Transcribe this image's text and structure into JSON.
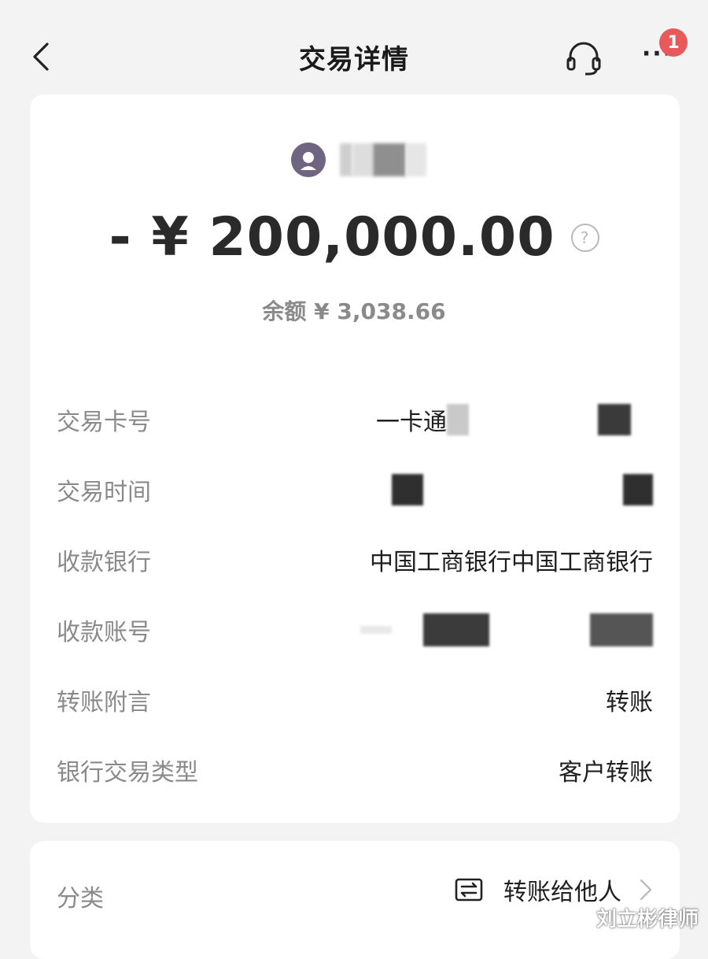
{
  "header": {
    "title": "交易详情",
    "notification_count": "1",
    "more_label": "···"
  },
  "transaction": {
    "amount": "- ¥ 200,000.00",
    "help_symbol": "?",
    "balance": "余额 ¥ 3,038.66"
  },
  "details": [
    {
      "label": "交易卡号",
      "value": "一卡通"
    },
    {
      "label": "交易时间",
      "value": ""
    },
    {
      "label": "收款银行",
      "value": "中国工商银行中国工商银行"
    },
    {
      "label": "收款账号",
      "value": ""
    },
    {
      "label": "转账附言",
      "value": "转账"
    },
    {
      "label": "银行交易类型",
      "value": "客户转账"
    }
  ],
  "category": {
    "label": "分类",
    "value": "转账给他人"
  },
  "watermark": "刘立彬律师",
  "colors": {
    "background": "#f3f3f3",
    "card": "#ffffff",
    "badge": "#e85a5a",
    "avatar": "#6f6583",
    "label_gray": "#8a8a8a"
  }
}
